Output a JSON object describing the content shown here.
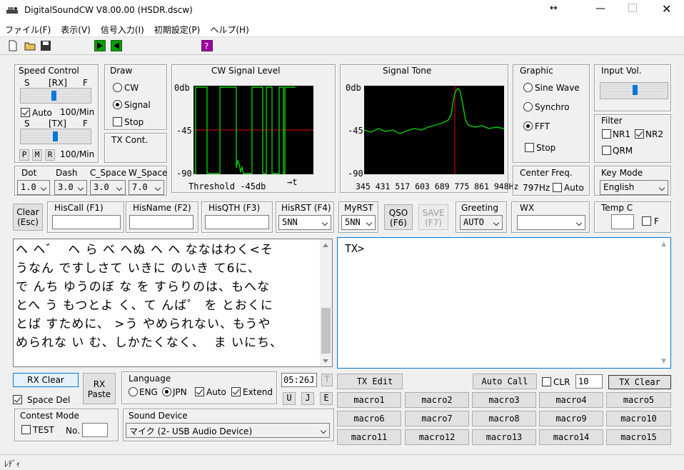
{
  "window": {
    "title": "DigitalSoundCW V8.00.00  (HSDR.dscw)"
  },
  "menu": [
    "ファイル(F)",
    "表示(V)",
    "信号入力(I)",
    "初期設定(P)",
    "ヘルプ(H)"
  ],
  "speed_control": {
    "title": "Speed Control",
    "rx_s": "S",
    "rx_label": "[RX]",
    "rx_f": "F",
    "rx_level": 0.45,
    "auto_label": "Auto",
    "auto_checked": true,
    "rx_speed": "100/Min",
    "tx_s": "S",
    "tx_label": "[TX]",
    "tx_f": "F",
    "tx_level": 0.48,
    "pmr": [
      "P",
      "M",
      "R"
    ],
    "tx_speed": "100/Min"
  },
  "draw": {
    "title": "Draw",
    "cw": "CW",
    "signal": "Signal",
    "stop": "Stop",
    "selected": "Signal"
  },
  "tx_cont": {
    "title": "TX Cont."
  },
  "cw_level": {
    "title": "CW Signal Level",
    "y_top": "0db",
    "y_mid": "-45",
    "y_bot": "-90",
    "threshold": "Threshold -45db",
    "time": "→t"
  },
  "signal_tone": {
    "title": "Signal Tone",
    "y_top": "0db",
    "y_mid": "-45",
    "y_bot": "-90",
    "freqs": "345 431 517 603 689 775 861 948Hz"
  },
  "graphic": {
    "title": "Graphic",
    "sine": "Sine Wave",
    "synchro": "Synchro",
    "fft": "FFT",
    "stop": "Stop",
    "selected": "FFT"
  },
  "input_vol": {
    "title": "Input Vol.",
    "level": 0.5
  },
  "filter": {
    "title": "Filter",
    "nr1": "NR1",
    "nr2": "NR2",
    "qrm": "QRM",
    "nr2_checked": true
  },
  "center_freq": {
    "title": "Center Freq.",
    "value": "797Hz",
    "auto": "Auto"
  },
  "key_mode": {
    "title": "Key Mode",
    "value": "English"
  },
  "spaces": {
    "dot": {
      "label": "Dot",
      "value": "1.0"
    },
    "dash": {
      "label": "Dash",
      "value": "3.0"
    },
    "c_space": {
      "label": "C_Space",
      "value": "3.0"
    },
    "w_space": {
      "label": "W_Space",
      "value": "7.0"
    }
  },
  "qso": {
    "clear": "Clear",
    "esc": "(Esc)",
    "hiscall": "HisCall (F1)",
    "hisname": "HisName (F2)",
    "hisqth": "HisQTH (F3)",
    "hisrst": "HisRST (F4)",
    "hisrst_value": "5NN",
    "myrst": "MyRST",
    "myrst_value": "5NN",
    "qso_btn": "QSO",
    "qso_key": "(F6)",
    "save_btn": "SAVE",
    "save_key": "(F7)",
    "greeting": "Greeting",
    "greeting_value": "AUTO",
    "wx": "WX",
    "temp": "Temp C",
    "f": "F"
  },
  "rx_text": [
    "ヘ ヘ゛  ヘ ら ベ ヘぬ ヘ ヘ ななはわく<そ",
    "うなん ですしさて いきに のいき て6に、",
    "で んち ゆうのぼ な を すらりのは、もへな",
    "とへ う もつとよ く、て んば゜ を とおくに",
    "とば すために、 >う やめられない、もうや",
    "められな い む、しかたくなく、  ま いにち、"
  ],
  "tx_text": "TX>",
  "bottom": {
    "rx_clear": "RX Clear",
    "rx": "RX",
    "paste": "Paste",
    "space_del": "Space Del",
    "language": "Language",
    "eng": "ENG",
    "jpn": "JPN",
    "auto": "Auto",
    "extend": "Extend",
    "time": "05:26J",
    "t": "T",
    "u": "U",
    "j": "J",
    "e": "E",
    "contest": "Contest Mode",
    "test": "TEST",
    "no": "No.",
    "sound_device": "Sound Device",
    "device_value": "マイク (2- USB Audio Device)",
    "tx_edit": "TX Edit",
    "auto_call": "Auto Call",
    "clr": "CLR",
    "clr_value": "10",
    "tx_clear": "TX Clear"
  },
  "macros": [
    "macro1",
    "macro2",
    "macro3",
    "macro4",
    "macro5",
    "macro6",
    "macro7",
    "macro8",
    "macro9",
    "macro10",
    "macro11",
    "macro12",
    "macro13",
    "macro14",
    "macro15"
  ],
  "status": "ﾚﾃﾞｨ",
  "colors": {
    "scope_bg": "#000000",
    "trace": "#00d000",
    "threshold": "#c00000",
    "accent": "#0078d7"
  }
}
